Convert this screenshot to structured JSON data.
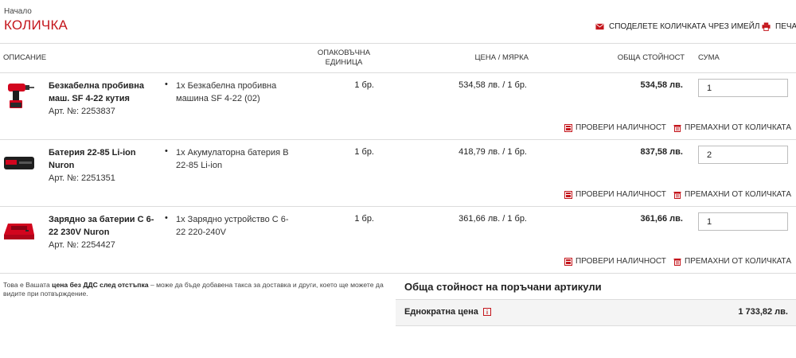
{
  "breadcrumb": "Начало",
  "page_title": "КОЛИЧКА",
  "actions": {
    "share_label": "СПОДЕЛЕТЕ КОЛИЧКАТА ЧРЕЗ ИМЕЙЛ",
    "print_label": "ПЕЧАТ"
  },
  "columns": {
    "description": "ОПИСАНИЕ",
    "pack_unit": "ОПАКОВЪЧНА ЕДИНИЦА",
    "unit_price": "ЦЕНА / МЯРКА",
    "total": "ОБЩА СТОЙНОСТ",
    "qty": "СУМА"
  },
  "items": [
    {
      "name": "Безкабелна пробивна маш. SF 4-22 кутия",
      "article": "Арт. №: 2253837",
      "includes": "1x Безкабелна пробивна машина SF 4-22 (02)",
      "pack": "1 бр.",
      "price": "534,58 лв. / 1 бр.",
      "total": "534,58 лв.",
      "qty": "1",
      "icon": "drill-icon"
    },
    {
      "name": "Батерия 22-85 Li-ion Nuron",
      "article": "Арт. №: 2251351",
      "includes": "1x Акумулаторна батерия B 22-85 Li-ion",
      "pack": "1 бр.",
      "price": "418,79 лв. / 1 бр.",
      "total": "837,58 лв.",
      "qty": "2",
      "icon": "battery-icon"
    },
    {
      "name": "Зарядно за батерии C 6-22 230V Nuron",
      "article": "Арт. №: 2254427",
      "includes": "1x Зарядно устройство C 6-22 220-240V",
      "pack": "1 бр.",
      "price": "361,66 лв. / 1 бр.",
      "total": "361,66 лв.",
      "qty": "1",
      "icon": "charger-icon"
    }
  ],
  "row_actions": {
    "check_label": "ПРОВЕРИ НАЛИЧНОСТ",
    "remove_label": "ПРЕМАХНИ ОТ КОЛИЧКАТА"
  },
  "note": {
    "pre": "Това е Вашата ",
    "bold": "цена без ДДС след отстъпка",
    "post": " – може да бъде добавена такса за доставка и други, което ще можете да видите при потвърждение."
  },
  "summary": {
    "title": "Обща стойност на поръчани артикули",
    "label": "Еднократна цена",
    "value": "1 733,82 лв."
  },
  "colors": {
    "brand": "#c4161c",
    "tool_red": "#d2051e",
    "tool_black": "#1e1e1e"
  }
}
